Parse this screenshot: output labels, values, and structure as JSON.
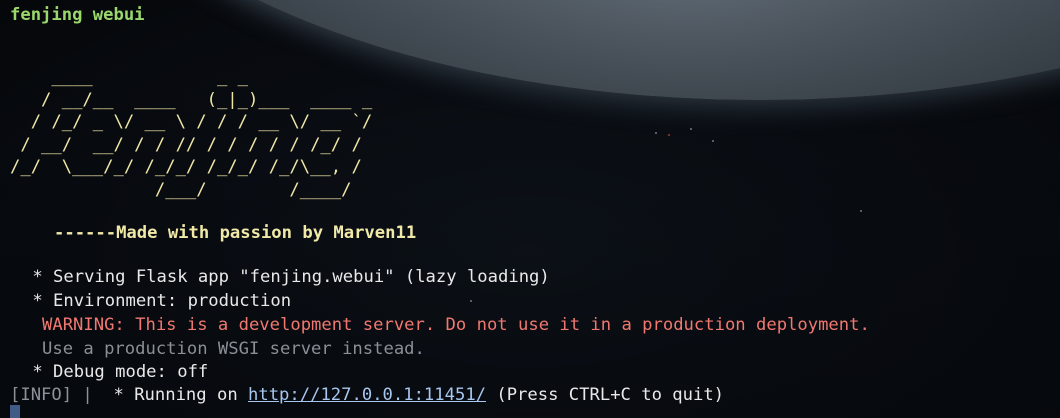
{
  "window": {
    "title": "fenjing webui"
  },
  "banner": {
    "ascii_art": "    ____            _ _\n   / __/__  ____   (_|_)___  ____ _\n  / /_/ _ \\/ __ \\ / / / __ \\/ __ `/\n / __/  __/ / / // / / / / / /_/ /\n/_/  \\___/_/ /_/_/ /_/_/ /_/\\__, /\n              /___/        /____/",
    "tagline": "------Made with passion by Marven11"
  },
  "log": {
    "serving": " * Serving Flask app \"fenjing.webui\" (lazy loading)",
    "environment": " * Environment: production",
    "warning": "WARNING: This is a development server. Do not use it in a production deployment.",
    "hint": "Use a production WSGI server instead.",
    "debug": " * Debug mode: off",
    "running_prefix": "[INFO] |",
    "running_text": "  * Running on ",
    "running_url": "http://127.0.0.1:11451/",
    "running_suffix": " (Press CTRL+C to quit)"
  },
  "colors": {
    "title": "#9ad86c",
    "ascii": "#efe6a6",
    "warning": "#f07870",
    "hint": "#8a9096",
    "url": "#a7c7ef",
    "text": "#e9e9e9",
    "cursor": "#3f5b86"
  }
}
